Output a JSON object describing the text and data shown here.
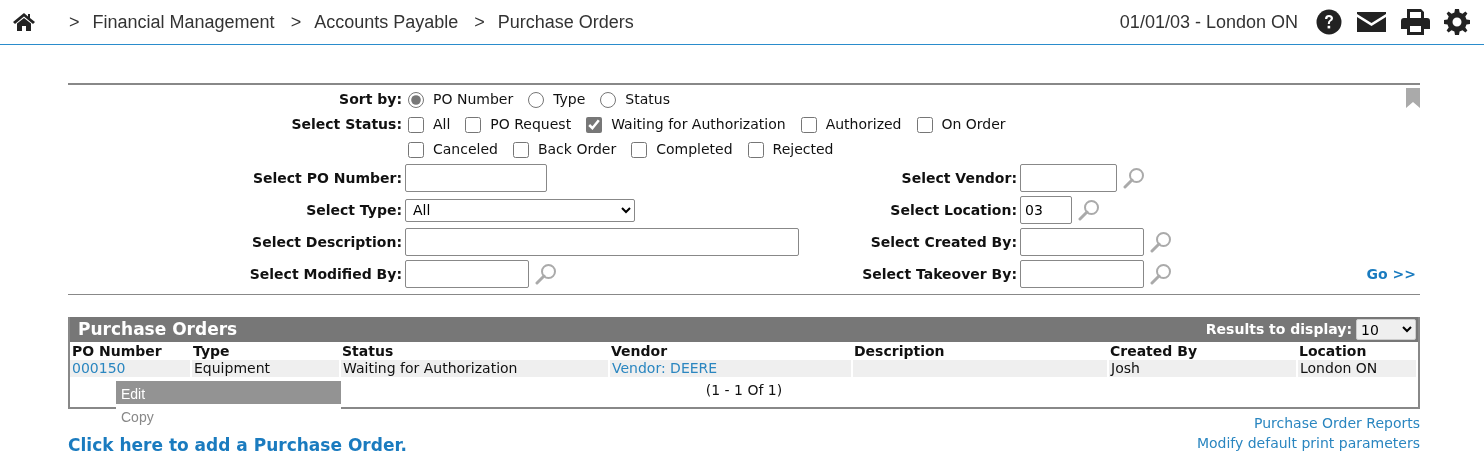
{
  "header": {
    "crumbs": [
      {
        "separator": ">",
        "label": "Financial Management"
      },
      {
        "separator": ">",
        "label": "Accounts Payable"
      },
      {
        "separator": ">",
        "label": "Purchase Orders"
      }
    ],
    "context": "01/01/03 - London ON"
  },
  "sort_by": {
    "label": "Sort by:",
    "options": [
      {
        "label": "PO Number",
        "selected": true
      },
      {
        "label": "Type",
        "selected": false
      },
      {
        "label": "Status",
        "selected": false
      }
    ]
  },
  "status_filter": {
    "label": "Select Status:",
    "rows": [
      [
        {
          "label": "All",
          "checked": false
        },
        {
          "label": "PO Request",
          "checked": false
        },
        {
          "label": "Waiting for Authorization",
          "checked": true
        },
        {
          "label": "Authorized",
          "checked": false
        },
        {
          "label": "On Order",
          "checked": false
        }
      ],
      [
        {
          "label": "Canceled",
          "checked": false
        },
        {
          "label": "Back Order",
          "checked": false
        },
        {
          "label": "Completed",
          "checked": false
        },
        {
          "label": "Rejected",
          "checked": false
        }
      ]
    ]
  },
  "left_fields": [
    {
      "label": "Select PO Number:",
      "kind": "text",
      "lookup": false
    },
    {
      "label": "Select Type:",
      "kind": "select",
      "value": "All",
      "lookup": false
    },
    {
      "label": "Select Description:",
      "kind": "text",
      "lookup": false
    },
    {
      "label": "Select Modified By:",
      "kind": "text",
      "lookup": true
    }
  ],
  "right_fields": [
    {
      "label": "Select Vendor:",
      "kind": "text",
      "lookup": true
    },
    {
      "label": "Select Location:",
      "kind": "text",
      "value": "03",
      "lookup": true
    },
    {
      "label": "Select Created By:",
      "kind": "text",
      "lookup": true
    },
    {
      "label": "Select Takeover By:",
      "kind": "text",
      "lookup": true
    }
  ],
  "go_link": "Go >>",
  "results": {
    "title": "Purchase Orders",
    "display_label": "Results to display:",
    "display_value": "10",
    "columns": [
      "PO Number",
      "Type",
      "Status",
      "Vendor",
      "Description",
      "Created By",
      "Location"
    ],
    "rows": [
      {
        "cells": [
          {
            "kind": "link",
            "text": "000150"
          },
          {
            "kind": "text",
            "text": "Equipment"
          },
          {
            "kind": "text",
            "text": "Waiting for Authorization"
          },
          {
            "kind": "link",
            "text": "Vendor: DEERE"
          },
          {
            "kind": "text"
          },
          {
            "kind": "text",
            "text": "Josh"
          },
          {
            "kind": "text",
            "text": "London ON"
          }
        ]
      }
    ],
    "pagination": "(1 - 1 Of 1)"
  },
  "context_menu": {
    "items": [
      {
        "label": "Edit",
        "selected": true
      },
      {
        "label": "Copy",
        "selected": false
      }
    ]
  },
  "add_link": "Click here to add a Purchase Order.",
  "footer_links": [
    "Purchase Order Reports",
    "Modify default print parameters"
  ]
}
